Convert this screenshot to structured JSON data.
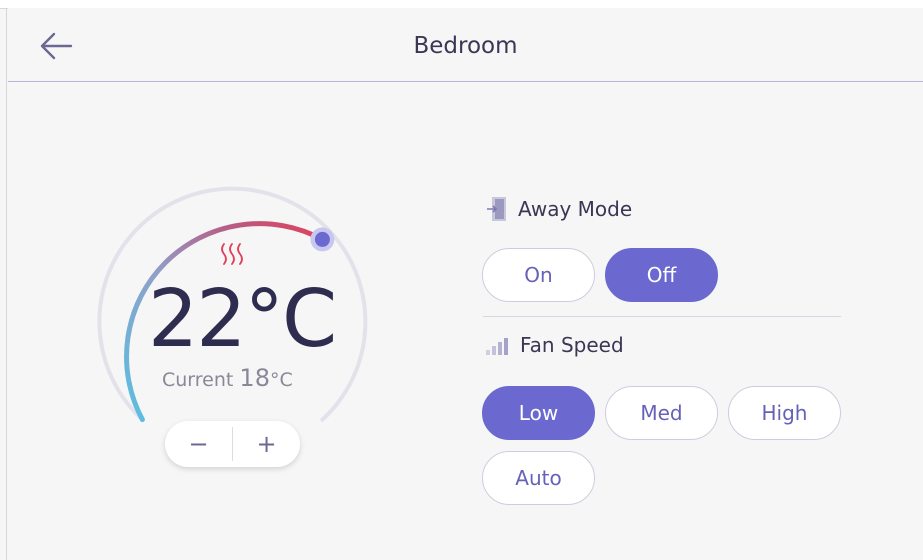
{
  "header": {
    "title": "Bedroom",
    "back_icon": "arrow-left-icon"
  },
  "thermostat": {
    "target_value": "22",
    "target_unit": "°C",
    "current_label": "Current",
    "current_value": "18",
    "current_unit": "°C",
    "minus_label": "−",
    "plus_label": "+",
    "heating_icon": "heat-waves-icon",
    "colors": {
      "cold": "#5bbfe0",
      "warm": "#e2405a",
      "knob": "#6b69cf"
    }
  },
  "away_mode": {
    "label": "Away Mode",
    "icon": "door-exit-icon",
    "options": [
      {
        "label": "On",
        "selected": false
      },
      {
        "label": "Off",
        "selected": true
      }
    ]
  },
  "fan_speed": {
    "label": "Fan Speed",
    "icon": "signal-bars-icon",
    "options": [
      {
        "label": "Low",
        "selected": true
      },
      {
        "label": "Med",
        "selected": false
      },
      {
        "label": "High",
        "selected": false
      },
      {
        "label": "Auto",
        "selected": false
      }
    ]
  },
  "accent_color": "#6b69cf"
}
